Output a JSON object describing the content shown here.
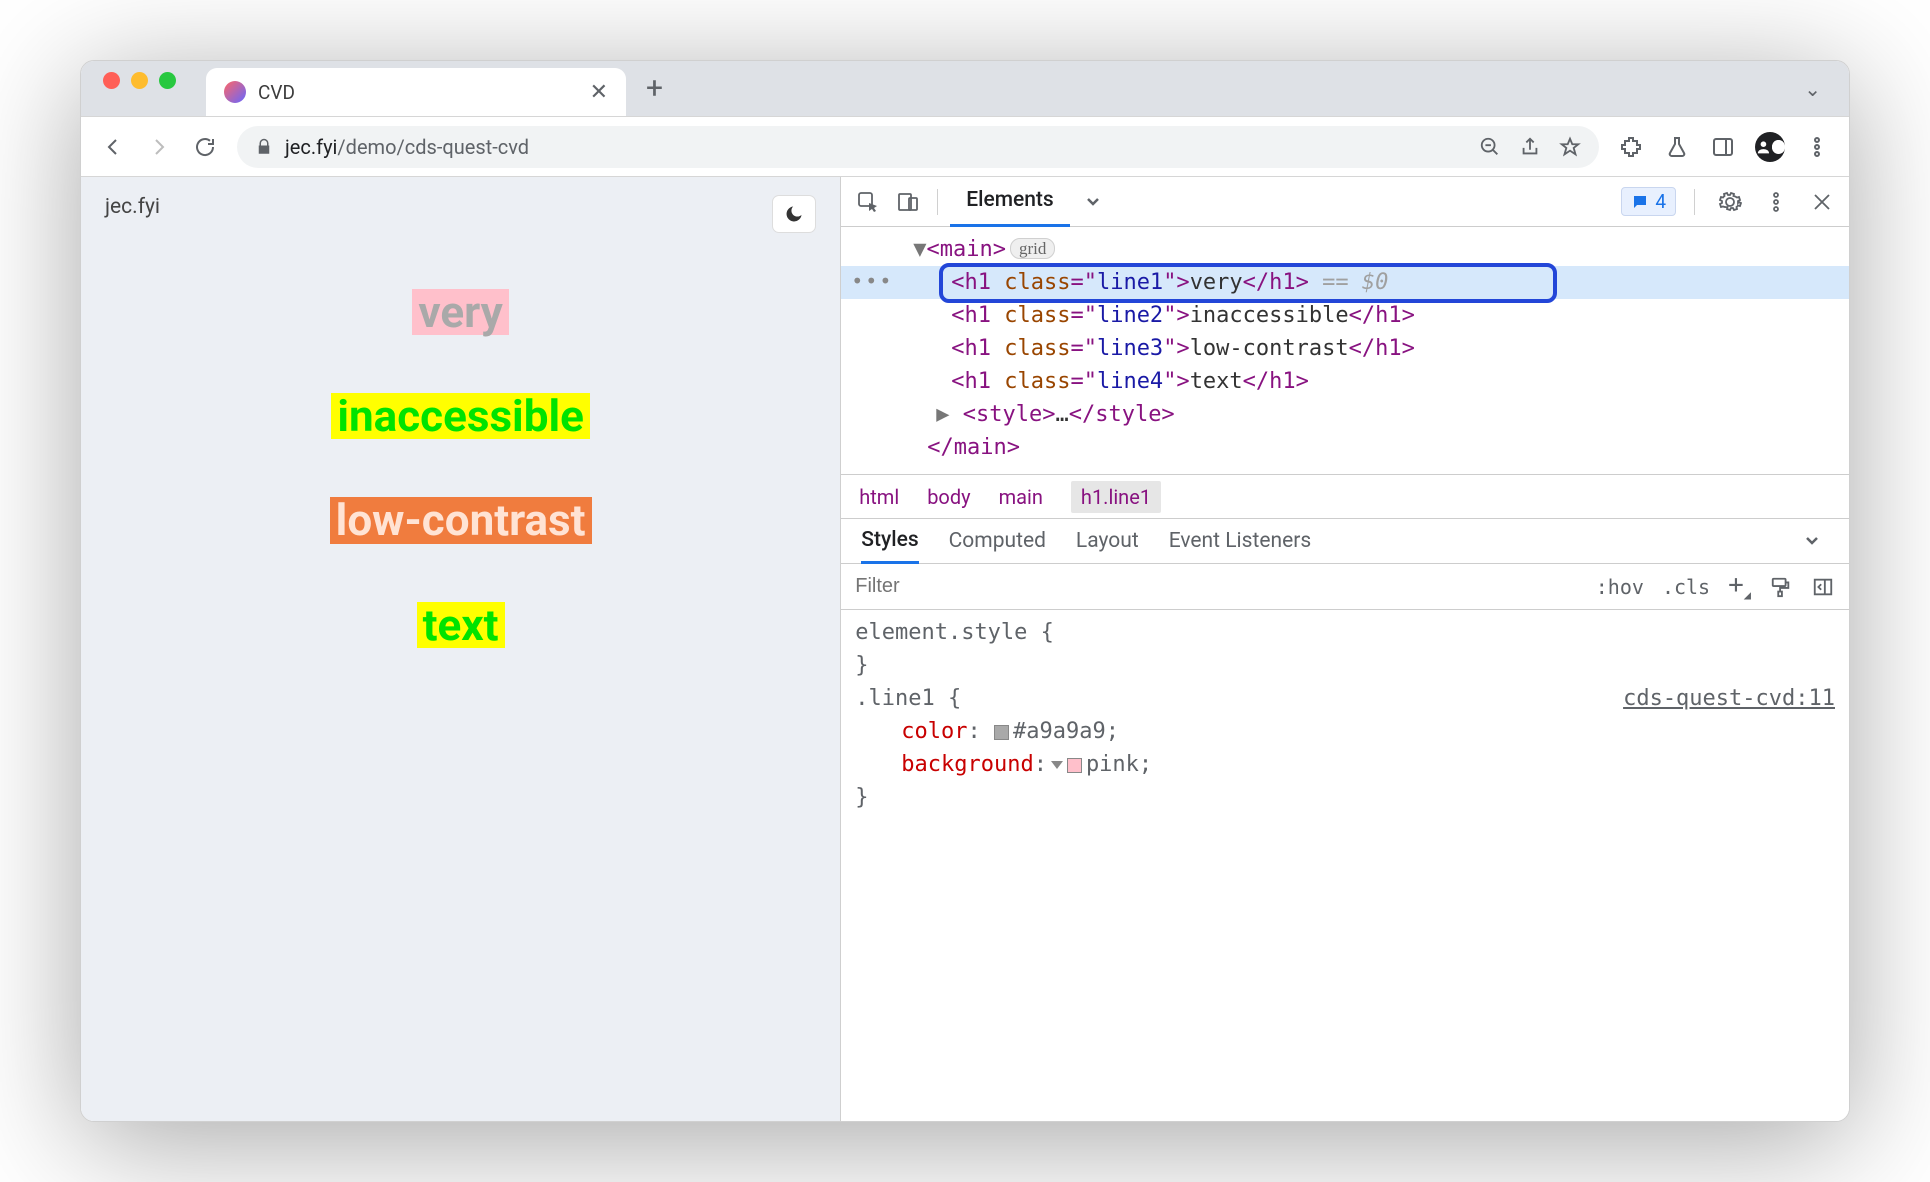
{
  "tab": {
    "title": "CVD"
  },
  "url": {
    "host": "jec.fyi",
    "path": "/demo/cds-quest-cvd"
  },
  "page": {
    "brand": "jec.fyi",
    "words": [
      "very",
      "inaccessible",
      "low-contrast",
      "text"
    ]
  },
  "devtools": {
    "tabs": {
      "elements": "Elements"
    },
    "issues_count": "4",
    "dom": {
      "main_open": "main",
      "grid_badge": "grid",
      "h1": [
        {
          "cls": "line1",
          "txt": "very",
          "anno": " == $0"
        },
        {
          "cls": "line2",
          "txt": "inaccessible",
          "anno": ""
        },
        {
          "cls": "line3",
          "txt": "low-contrast",
          "anno": ""
        },
        {
          "cls": "line4",
          "txt": "text",
          "anno": ""
        }
      ],
      "style_collapsed": "style",
      "main_close": "main"
    },
    "breadcrumb": [
      "html",
      "body",
      "main",
      "h1.line1"
    ],
    "styles_tabs": [
      "Styles",
      "Computed",
      "Layout",
      "Event Listeners"
    ],
    "filter_placeholder": "Filter",
    "hov": ":hov",
    "cls": ".cls",
    "rules": {
      "element_style": "element.style {",
      "brace_close": "}",
      "selector": ".line1 {",
      "source": "cds-quest-cvd:11",
      "color_prop": "color",
      "color_val": "#a9a9a9",
      "bg_prop": "background",
      "bg_val": "pink"
    }
  }
}
